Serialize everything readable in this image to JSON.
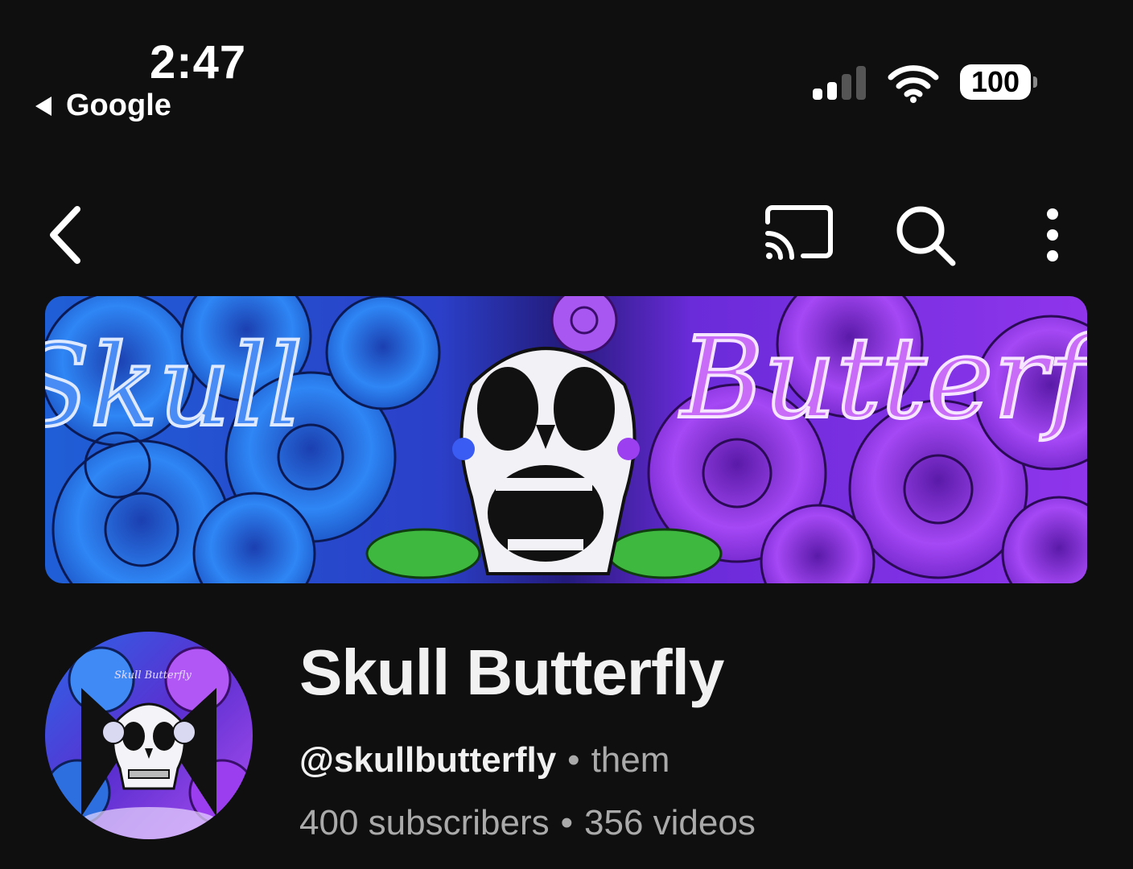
{
  "status_bar": {
    "time": "2:47",
    "back_app_label": "Google",
    "battery_level": "100",
    "signal_bars_filled": 2,
    "signal_bars_total": 4
  },
  "app_bar": {
    "back_icon": "chevron-left-icon",
    "cast_icon": "cast-icon",
    "search_icon": "search-icon",
    "more_icon": "more-vertical-icon"
  },
  "banner": {
    "left_text": "Skull",
    "right_text": "Butterfly",
    "colors": {
      "blue": "#2f7df2",
      "purple": "#9b3ff0",
      "center": "#2a1f8c"
    }
  },
  "channel": {
    "name": "Skull Butterfly",
    "handle": "@skullbutterfly",
    "pronouns": "them",
    "subscribers": "400 subscribers",
    "videos": "356 videos",
    "avatar_script_text": "Skull Butterfly"
  },
  "theme": {
    "background": "#0f0f0f",
    "text_primary": "#f1f1f1",
    "text_secondary": "#aaaaaa"
  }
}
